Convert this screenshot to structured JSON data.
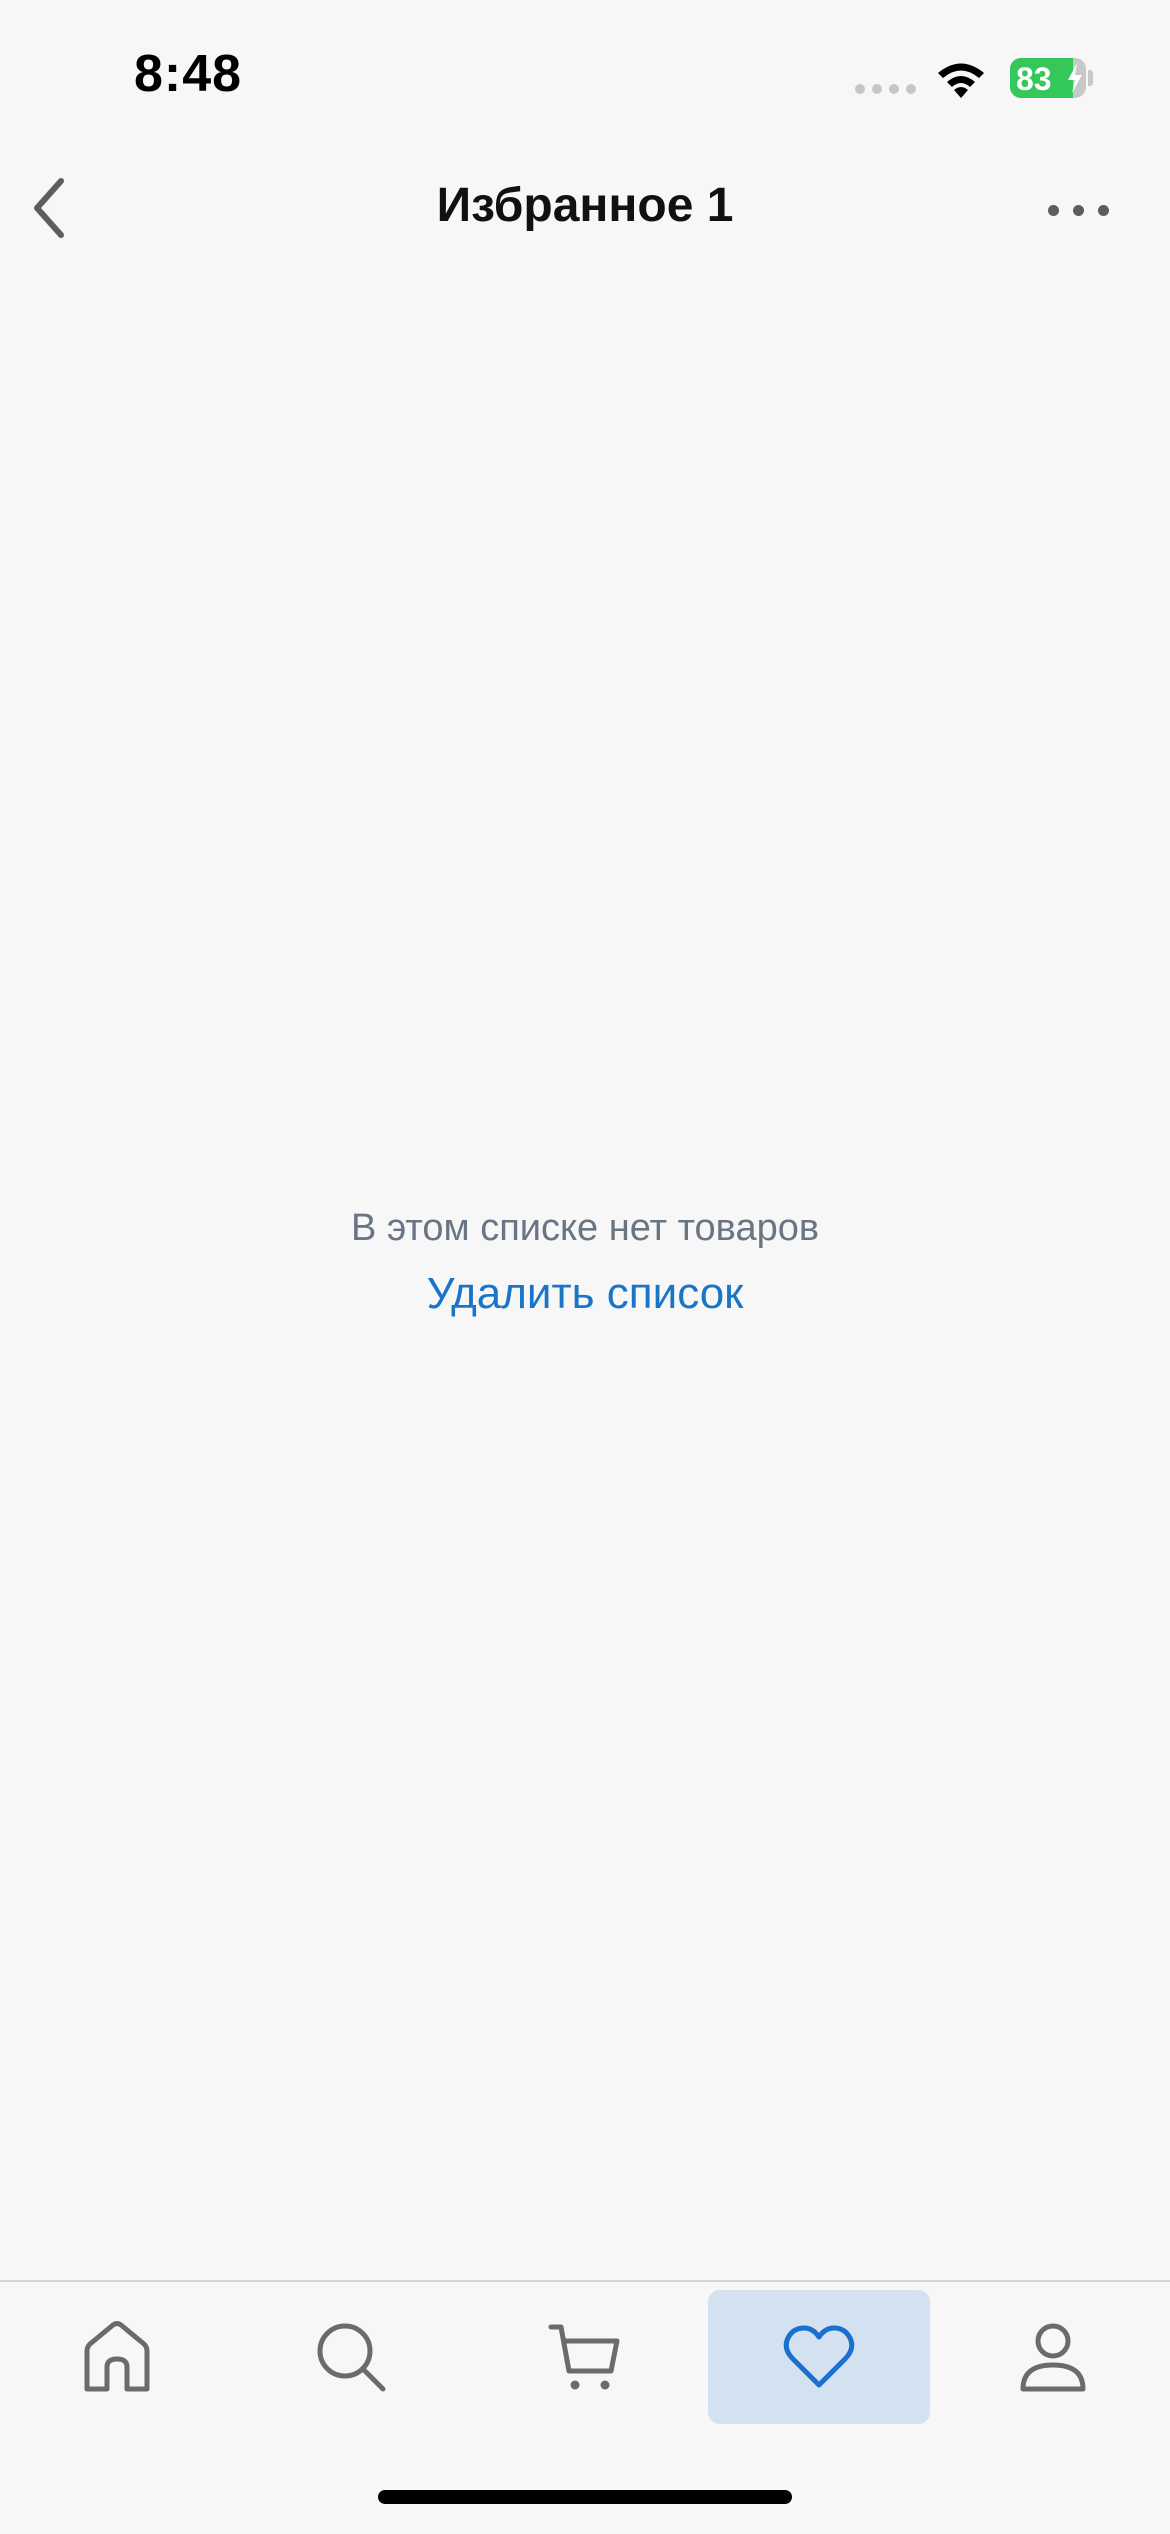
{
  "status_bar": {
    "time": "8:48",
    "battery_level": "83",
    "battery_fraction": 0.83,
    "battery_color": "#34c759"
  },
  "nav": {
    "title": "Избранное 1",
    "back_icon": "chevron-left-icon",
    "more_icon": "more-horizontal-icon"
  },
  "empty_state": {
    "message": "В этом списке нет товаров",
    "action_label": "Удалить список"
  },
  "tab_bar": {
    "tabs": [
      {
        "name": "home",
        "icon": "home-icon",
        "active": false
      },
      {
        "name": "search",
        "icon": "search-icon",
        "active": false
      },
      {
        "name": "cart",
        "icon": "cart-icon",
        "active": false
      },
      {
        "name": "favorites",
        "icon": "heart-icon",
        "active": true
      },
      {
        "name": "profile",
        "icon": "user-icon",
        "active": false
      }
    ],
    "active_color": "#1a6fcf",
    "inactive_color": "#6b6b6b",
    "active_background": "#d3e1f1"
  },
  "colors": {
    "background": "#f7f7f7",
    "link": "#1a74c8",
    "muted_text": "#6a7584"
  }
}
